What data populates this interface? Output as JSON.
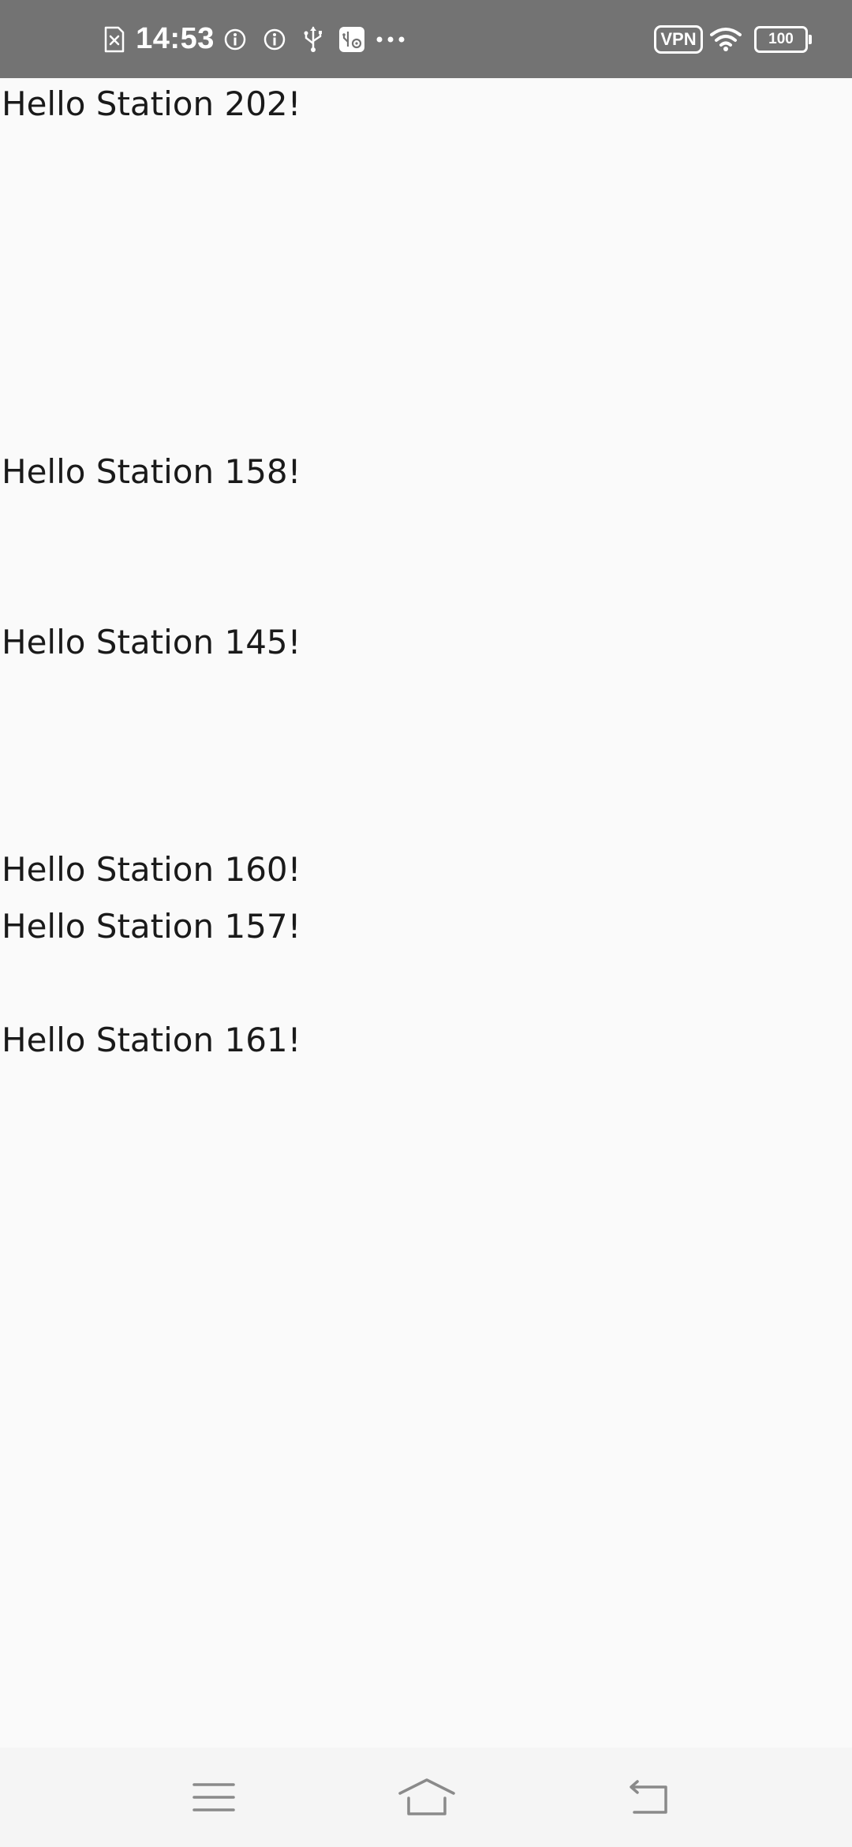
{
  "status_bar": {
    "time": "14:53",
    "vpn_label": "VPN",
    "battery_level": "100",
    "icons": [
      "sim-error-icon",
      "info-icon",
      "info-icon",
      "usb-icon",
      "usb-settings-icon",
      "more-dots-icon",
      "vpn-icon",
      "wifi-icon",
      "battery-icon"
    ]
  },
  "stations": [
    "Hello Station 202!",
    "Hello Station 158!",
    "Hello Station 145!",
    "Hello Station 160!",
    "Hello Station 157!",
    "Hello Station 161!"
  ],
  "nav_bar": {
    "buttons": [
      "menu-icon",
      "home-icon",
      "back-icon"
    ]
  }
}
